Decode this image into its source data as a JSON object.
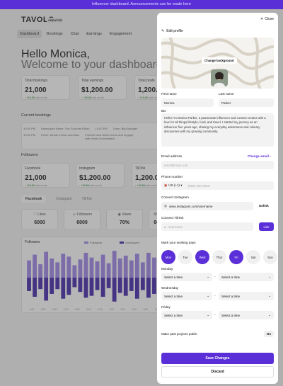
{
  "banner": {
    "text": "Influencer dashboard. Announcements can be made here"
  },
  "app": {
    "logo": "TAVOLO",
    "badge": "CREATOR"
  },
  "nav": {
    "tabs": [
      "Dashboard",
      "Bookings",
      "Chat",
      "Earnings",
      "Engagement"
    ],
    "active": "Dashboard"
  },
  "greeting": {
    "hello": "Hello Monica,",
    "welcome": "Welcome to your dashboard"
  },
  "stats": [
    {
      "label": "Total bookings",
      "value": "21,000",
      "trend": "+10.4%",
      "trend_suffix": "last month"
    },
    {
      "label": "Total earnings",
      "value": "$1,200.00",
      "trend": "+10.4%",
      "trend_suffix": "last month"
    },
    {
      "label": "Total posts",
      "value": "1,200.00",
      "trend": "+10.4%",
      "trend_suffix": "last month"
    }
  ],
  "schedule": {
    "title": "Current bookings",
    "rows": [
      [
        "10:00 PM",
        "Restaurant Name: The Gourmet Bistro",
        "10:00 PM",
        "Team: Big Manager"
      ],
      [
        "10:00 PM",
        "Event: Dinner event promotion",
        "",
        "Post the new winter menu and engage with diners for feedback"
      ]
    ]
  },
  "followers": {
    "title": "Followers",
    "cards": [
      {
        "label": "Facebook",
        "value": "21,000",
        "trend": "+10.4%",
        "trend_suffix": "last month"
      },
      {
        "label": "Instagram",
        "value": "$1,200.00",
        "trend": "+10.4%",
        "trend_suffix": "last month"
      },
      {
        "label": "TikTok",
        "value": "1,200.00",
        "trend": "+10.4%",
        "trend_suffix": "last month"
      }
    ]
  },
  "social_tabs": {
    "items": [
      "Facebook",
      "Instagram",
      "TikTok"
    ],
    "active": "Facebook"
  },
  "metrics": [
    {
      "label": "Likes",
      "value": "6000"
    },
    {
      "label": "Followers",
      "value": "6000"
    },
    {
      "label": "Views",
      "value": "70%"
    },
    {
      "label": "Shares",
      "value": "6000"
    }
  ],
  "chart_data": {
    "type": "bar",
    "title": "Followers",
    "series": [
      {
        "name": "Followers",
        "values": [
          18,
          24,
          14,
          27,
          20,
          16,
          25,
          22,
          13,
          19,
          26,
          21,
          17,
          24,
          15,
          28,
          20,
          23,
          18,
          25,
          16,
          26,
          21,
          19
        ]
      },
      {
        "name": "Unfollowed",
        "values": [
          -14,
          -20,
          -12,
          -24,
          -17,
          -12,
          -22,
          -18,
          -10,
          -15,
          -21,
          -19,
          -13,
          -20,
          -11,
          -25,
          -16,
          -19,
          -14,
          -22,
          -13,
          -21,
          -17,
          -15
        ]
      }
    ],
    "tick_labels": [
      "0:00",
      "0:00",
      "0:00",
      "0:00",
      "0:00",
      "0:00",
      "0:00",
      "0:00",
      "0:00",
      "0:00",
      "0:00",
      "0:00"
    ],
    "colors": {
      "Followers": "#9b82e8",
      "Unfollowed": "#3d1fa8"
    }
  },
  "panel": {
    "close_label": "Close",
    "title": "Edit profile",
    "change_bg_label": "Change background",
    "first_name": {
      "label": "First name",
      "value": "Monica"
    },
    "last_name": {
      "label": "Last name",
      "value": "Parker"
    },
    "bio": {
      "label": "Bio",
      "value": "Hello! I'm Monica Parker, a passionate influencer and content creator with a love for all things lifestyle, food, and travel. I started my journey as an influencer five years ago, sharing my everyday adventures and culinary discoveries with my growing community."
    },
    "email": {
      "label": "Email address",
      "change_label": "Change email",
      "placeholder": "email@mail.com"
    },
    "phone": {
      "label": "Phone number",
      "country": "US",
      "code": "(+1)",
      "placeholder": "(555) 000-0000"
    },
    "instagram": {
      "label": "Connect Instagram",
      "value": "www.instagram.com/username",
      "action": "Unlink"
    },
    "tiktok": {
      "label": "Connect TikTok",
      "placeholder": "Username",
      "action": "Link"
    },
    "days": {
      "label": "Mark your working days",
      "items": [
        {
          "label": "Mon",
          "selected": true
        },
        {
          "label": "Tue",
          "selected": false
        },
        {
          "label": "Wed",
          "selected": true
        },
        {
          "label": "Thur",
          "selected": false
        },
        {
          "label": "Fri",
          "selected": true
        },
        {
          "label": "Sat",
          "selected": false
        },
        {
          "label": "Sun",
          "selected": false
        }
      ]
    },
    "time_blocks": [
      {
        "day": "Monday",
        "start": "Select a time",
        "end": "Select a time"
      },
      {
        "day": "Wednesday",
        "start": "Select a time",
        "end": "Select a time"
      },
      {
        "day": "Friday",
        "start": "Select a time",
        "end": "Select a time"
      }
    ],
    "past_projects": {
      "label": "Make past projects public",
      "state": "On"
    },
    "save_label": "Save Changes",
    "discard_label": "Discard",
    "accent": "#5b2fd8"
  }
}
